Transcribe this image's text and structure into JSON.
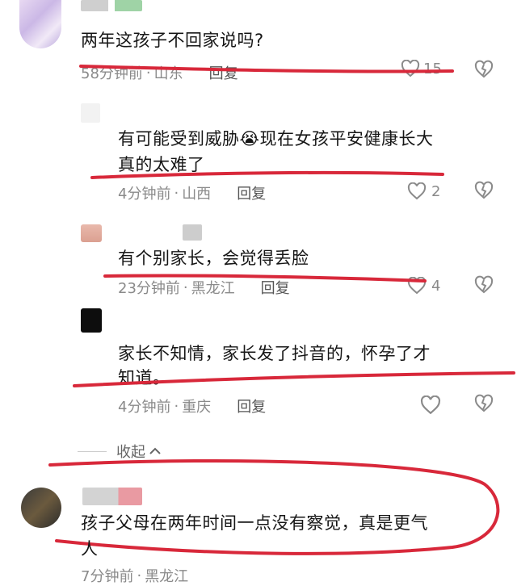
{
  "comments": [
    {
      "text": "两年这孩子不回家说吗?",
      "time": "58分钟前",
      "region": "山东",
      "reply": "回复",
      "likes": "15"
    },
    {
      "text_line1": "有可能受到威胁",
      "emoji": "😭",
      "text_line1b": "现在女孩平安健康长大",
      "text_line2": "真的太难了",
      "time": "4分钟前",
      "region": "山西",
      "reply": "回复",
      "likes": "2"
    },
    {
      "text": "有个别家长，会觉得丢脸",
      "time": "23分钟前",
      "region": "黑龙江",
      "reply": "回复",
      "likes": "4"
    },
    {
      "text_line1": "家长不知情，家长发了抖音的，怀孕了才",
      "text_line2": "知道。",
      "time": "4分钟前",
      "region": "重庆",
      "reply": "回复",
      "likes": ""
    },
    {
      "text_line1": "孩子父母在两年时间一点没有察觉，真是更气",
      "text_line2": "人",
      "time": "7分钟前",
      "region": "黑龙江",
      "reply": ""
    }
  ],
  "collapse_label": "收起",
  "separator": "·",
  "colors": {
    "annotation": "#d8283a",
    "meta": "#8a8a8a"
  }
}
